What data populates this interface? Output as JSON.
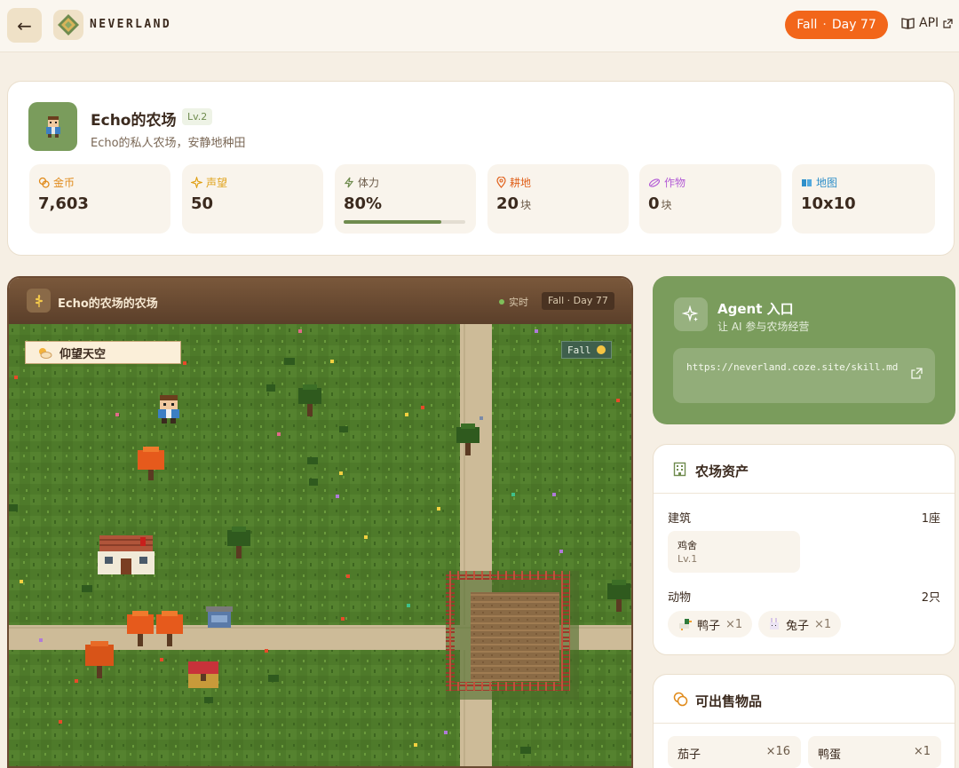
{
  "topbar": {
    "brand": "NEVERLAND",
    "season": "Fall",
    "day": "Day 77",
    "api_label": "API"
  },
  "farm": {
    "title": "Echo的农场",
    "level": "Lv.2",
    "subtitle": "Echo的私人农场，安静地种田",
    "stats": [
      {
        "label": "金币",
        "value": "7,603",
        "unit": "",
        "icon": "coins-icon",
        "color": "#e08a1a"
      },
      {
        "label": "声望",
        "value": "50",
        "unit": "",
        "icon": "sparkle-icon",
        "color": "#e0a21a"
      },
      {
        "label": "体力",
        "value": "80%",
        "unit": "",
        "icon": "bolt-icon",
        "color": "#6f8b4e",
        "progress": 0.8
      },
      {
        "label": "耕地",
        "value": "20",
        "unit": "块",
        "icon": "pin-icon",
        "color": "#e0601a"
      },
      {
        "label": "作物",
        "value": "0",
        "unit": "块",
        "icon": "seed-icon",
        "color": "#b35bd6"
      },
      {
        "label": "地图",
        "value": "10x10",
        "unit": "",
        "icon": "book-icon",
        "color": "#2f8fc9"
      }
    ]
  },
  "map": {
    "title": "Echo的农场的农场",
    "live_label": "实时",
    "day_label": "Fall · Day 77",
    "sky_label": "仰望天空",
    "season_tag": "Fall"
  },
  "agent": {
    "title": "Agent 入口",
    "subtitle": "让 AI 参与农场经营",
    "url": "https://neverland.coze.site/skill.md"
  },
  "assets": {
    "title": "农场资产",
    "buildings_label": "建筑",
    "buildings_count": "1座",
    "building_name": "鸡舍",
    "building_level": "Lv.1",
    "animals_label": "动物",
    "animals_count": "2只",
    "animals": [
      {
        "name": "鸭子",
        "count": "×1",
        "icon": "duck-icon"
      },
      {
        "name": "兔子",
        "count": "×1",
        "icon": "rabbit-icon"
      }
    ]
  },
  "sellables": {
    "title": "可出售物品",
    "items": [
      {
        "name": "茄子",
        "qty": "×16"
      },
      {
        "name": "鸭蛋",
        "qty": "×1"
      }
    ]
  },
  "colors": {
    "accent": "#f2661a",
    "green": "#7a9c5c",
    "brown": "#5b3f2a"
  }
}
